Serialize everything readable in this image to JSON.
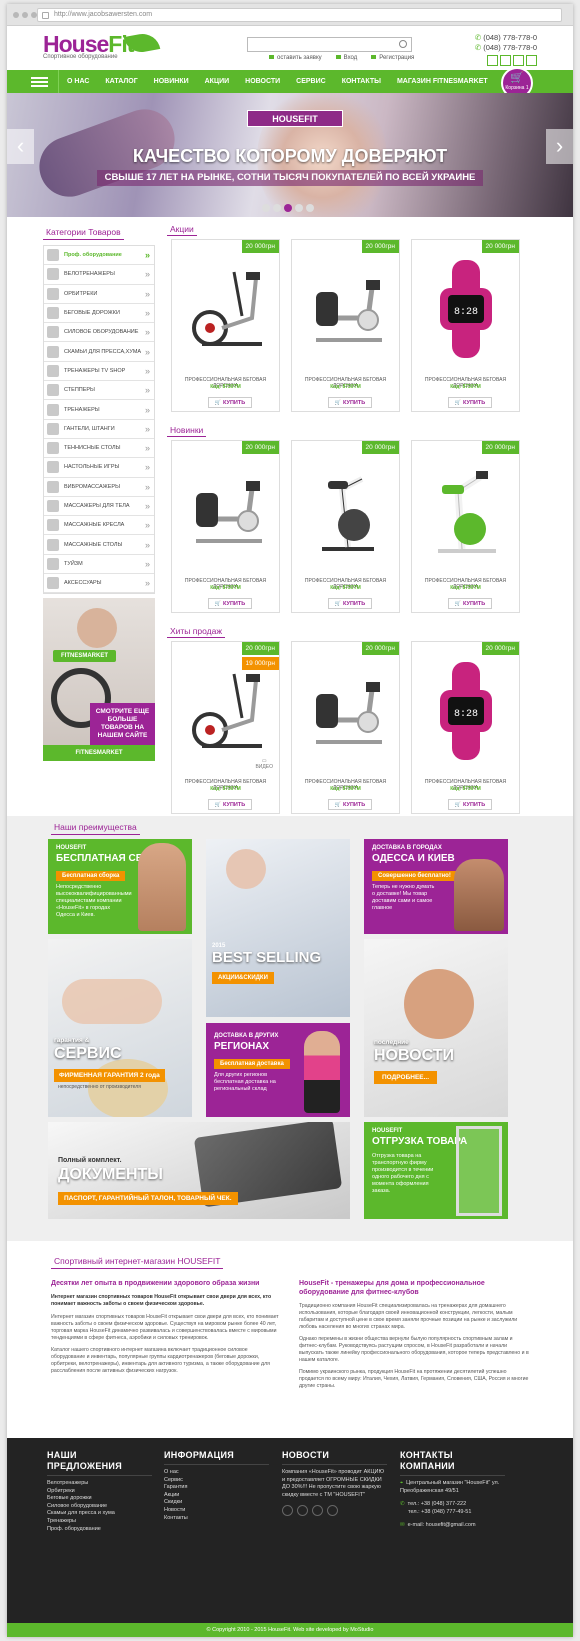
{
  "browser": {
    "url": "http://www.jacobsawersten.com"
  },
  "header": {
    "logo_name_a": "House",
    "logo_name_b": "Fit",
    "logo_tagline": "Спортивное оборудование",
    "links": [
      "оставить заявку",
      "Вход",
      "Регистрация"
    ],
    "phones": [
      "(048) 778-778-0",
      "(048) 778-778-0"
    ]
  },
  "nav": {
    "items": [
      "О НАС",
      "КАТАЛОГ",
      "НОВИНКИ",
      "АКЦИИ",
      "НОВОСТИ",
      "СЕРВИС",
      "КОНТАКТЫ",
      "МАГАЗИН FITNESMARKET"
    ],
    "cart_label": "Корзина",
    "cart_count": "1 шт"
  },
  "banner": {
    "badge": "HOUSEFIT",
    "headline": "КАЧЕСТВО КОТОРОМУ ДОВЕРЯЮТ",
    "subline": "СВЫШЕ 17 ЛЕТ НА РЫНКЕ, СОТНИ ТЫСЯЧ ПОКУПАТЕЛЕЙ ПО ВСЕЙ УКРАИНЕ",
    "active_slide": 3,
    "slide_count": 5
  },
  "sidebar": {
    "title": "Категории Товаров",
    "items": [
      "Проф. оборудование",
      "ВЕЛОТРЕНАЖЕРЫ",
      "ОРБИТРЕКИ",
      "БЕГОВЫЕ ДОРОЖКИ",
      "СИЛОВОЕ ОБОРУДОВАНИЕ",
      "СКАМЬИ ДЛЯ ПРЕССА,ХУМА",
      "ТРЕНАЖЕРЫ TV SHOP",
      "СТЕППЕРЫ",
      "ТРЕНАЖЕРЫ",
      "ГАНТЕЛИ, ШТАНГИ",
      "ТЕННИСНЫЕ СТОЛЫ",
      "НАСТОЛЬНЫЕ ИГРЫ",
      "ВИБРОМАССАЖЕРЫ",
      "МАССАЖЕРЫ ДЛЯ ТЕЛА",
      "МАССАЖНЫЕ КРЕСЛА",
      "МАССАЖНЫЕ СТОЛЫ",
      "ТУЙЗМ",
      "АКСЕССУАРЫ"
    ],
    "promo_badge": "FITNESMARKET",
    "promo_text": "СМОТРИТЕ ЕЩЕ БОЛЬШЕ ТОВАРОВ НА НАШЕМ САЙТЕ",
    "promo_footer": "FITNESMARKET"
  },
  "groups": [
    {
      "title": "Акции",
      "products": [
        {
          "price": "20 000грн",
          "name": "ПРОФЕССИОНАЛЬНАЯ БЕГОВАЯ ДОРОЖКА",
          "code": "Код: 8730ТМ",
          "buy": "КУПИТЬ",
          "img": "elliptical"
        },
        {
          "price": "20 000грн",
          "name": "ПРОФЕССИОНАЛЬНАЯ БЕГОВАЯ ДОРОЖКА",
          "code": "Код: 8730ТМ",
          "buy": "КУПИТЬ",
          "img": "recumbent"
        },
        {
          "price": "20 000грн",
          "name": "ПРОФЕССИОНАЛЬНАЯ БЕГОВАЯ ДОРОЖКА",
          "code": "Код: 8730ТМ",
          "buy": "КУПИТЬ",
          "img": "watch"
        }
      ]
    },
    {
      "title": "Новинки",
      "products": [
        {
          "price": "20 000грн",
          "name": "ПРОФЕССИОНАЛЬНАЯ БЕГОВАЯ ДОРОЖКА",
          "code": "Код: 8730ТМ",
          "buy": "КУПИТЬ",
          "img": "recumbent"
        },
        {
          "price": "20 000грн",
          "name": "ПРОФЕССИОНАЛЬНАЯ БЕГОВАЯ ДОРОЖКА",
          "code": "Код: 8730ТМ",
          "buy": "КУПИТЬ",
          "img": "bike"
        },
        {
          "price": "20 000грн",
          "name": "ПРОФЕССИОНАЛЬНАЯ БЕГОВАЯ ДОРОЖКА",
          "code": "Код: 8730ТМ",
          "buy": "КУПИТЬ",
          "img": "bikegreen"
        }
      ]
    },
    {
      "title": "Хиты продаж",
      "products": [
        {
          "price": "20 000грн",
          "old_price": "19 000грн",
          "name": "ПРОФЕССИОНАЛЬНАЯ БЕГОВАЯ ДОРОЖКА",
          "code": "Код: 8730ТМ",
          "buy": "КУПИТЬ",
          "img": "elliptical",
          "video": "ВИДЕО"
        },
        {
          "price": "20 000грн",
          "name": "ПРОФЕССИОНАЛЬНАЯ БЕГОВАЯ ДОРОЖКА",
          "code": "Код: 8730ТМ",
          "buy": "КУПИТЬ",
          "img": "recumbent"
        },
        {
          "price": "20 000грн",
          "name": "ПРОФЕССИОНАЛЬНАЯ БЕГОВАЯ ДОРОЖКА",
          "code": "Код: 8730ТМ",
          "buy": "КУПИТЬ",
          "img": "watch"
        }
      ]
    }
  ],
  "advantages": {
    "title": "Наши преимущества",
    "t1": {
      "small": "HOUSEFIT",
      "big": "БЕСПЛАТНАЯ СБОРКА",
      "chip": "Бесплатная сборка",
      "body": "Непосредственно высококвалифицированными специалистами компании «HouseFit» в городах Одесса и Киев."
    },
    "t2": {
      "small": "2015",
      "big": "BEST SELLING",
      "chip": "АКЦИИ&СКИДКИ"
    },
    "t3": {
      "small": "ДОСТАВКА В ГОРОДАХ",
      "big": "ОДЕССА И КИЕВ",
      "chip": "Совершенно бесплатно!",
      "body": "Теперь не нужно думать о доставке! Мы товар доставим сами и самое главное"
    },
    "t4": {
      "small": "гарантия &",
      "big": "СЕРВИС",
      "chip": "ФИРМЕННАЯ ГАРАНТИЯ 2 года",
      "body": "непосредственно от производителя"
    },
    "t5": {
      "small": "ДОСТАВКА В ДРУГИХ",
      "big": "РЕГИОНАХ",
      "chip": "Бесплатная доставка",
      "body": "Для других регионов бесплатная доставка на региональный склад"
    },
    "t6": {
      "small": "последние",
      "big": "НОВОСТИ",
      "chip": "ПОДРОБНЕЕ..."
    },
    "t7": {
      "small": "Полный комплект.",
      "big": "ДОКУМЕНТЫ",
      "chip": "ПАСПОРТ, ГАРАНТИЙНЫЙ ТАЛОН, ТОВАРНЫЙ ЧЕК."
    },
    "t8": {
      "small": "HOUSEFIT",
      "big": "ОТГРУЗКА ТОВАРА",
      "body": "Отгрузка товара на транспортную фирму производится в течении одного рабочего дня с момента оформления заказа."
    }
  },
  "about": {
    "title": "Спортивный интернет-магазин HOUSEFIT",
    "left_h": "Десятки лет опыта в продвижении здорового образа жизни",
    "left_lead": "Интернет магазин спортивных товаров HouseFit открывает свои двери для всех, кто понимает важность заботы о своем физическом здоровье.",
    "left_p1": "Интернет магазин спортивных товаров HouseFit открывает свои двери для всех, кто понимает важность заботы о своем физическом здоровье. Существуя на мировом рынке более 40 лет, торговая марка HouseFit динамично развивалась и совершенствовалась вместе с мировыми тенденциями в сфере фитнеса, аэробики и силовых тренировок.",
    "left_p2": "Каталог нашего спортивного интернет магазина включает традиционное силовое оборудование и инвентарь, популярные группы кардиотренажеров (беговые дорожки, орбитреки, велотренажеры), инвентарь для активного туризма, а также оборудование для расслабления после активных физических нагрузок.",
    "right_h": "HouseFit - тренажеры для дома и профессиональное оборудование для фитнес-клубов",
    "right_p1": "Традиционно компания HouseFit специализировалась на тренажерах для домашнего использования, которые благодаря своей инновационной конструкции, легкости, малым габаритам и доступной цене в свое время заняли прочные позиции на рынке и заслужили любовь населения во многих странах мира.",
    "right_p2": "Однако перемены в жизни общества вернули былую популярность спортивным залам и фитнес-клубам. Руководствуясь растущим спросом, в HouseFit разработали и начали выпускать также линейку профессионального оборудования, которое теперь представлено и в нашем каталоге.",
    "right_p3": "Помимо украинского рынка, продукция HouseFit на протяжении десятилетий успешно продается по всему миру: Италия, Чехия, Латвия, Германия, Словения, США, Россия и многие другие страны."
  },
  "footer": {
    "c1_title": "НАШИ ПРЕДЛОЖЕНИЯ",
    "c1_items": [
      "Велотренажеры",
      "Орбитреки",
      "Беговые дорожки",
      "Силовое оборудование",
      "Скамьи для пресса и хума",
      "Тренажеры",
      "Проф. оборудование"
    ],
    "c2_title": "ИНФОРМАЦИЯ",
    "c2_items": [
      "О нас",
      "Сервис",
      "Гарантия",
      "Акции",
      "Скидки",
      "Новости",
      "Контакты"
    ],
    "c3_title": "НОВОСТИ",
    "c3_text": "Компания «HouseFit» проводит АКЦИЮ и предоставляет ОГРОМНЫЕ СКИДКИ ДО 30%!!! Не пропустите свою жаркую скидку вместе с ТМ \"HOUSEFIT\"",
    "c4_title": "КОНТАКТЫ КОМПАНИИ",
    "c4_address": "Центральный магазин \"HouseFit\" ул. Преображенская 49/51",
    "c4_phone1": "тел.: +38 (048) 377-222",
    "c4_phone2": "тел.: +38 (048) 777-49-51",
    "c4_email": "e-mail: housefit@gmail.com",
    "copyright": "© Copyright 2010 - 2015 HouseFit. Web site developed by MoStudio"
  },
  "colors": {
    "accent_green": "#5cb82c",
    "accent_purple": "#9c2496",
    "accent_orange": "#f39200"
  }
}
